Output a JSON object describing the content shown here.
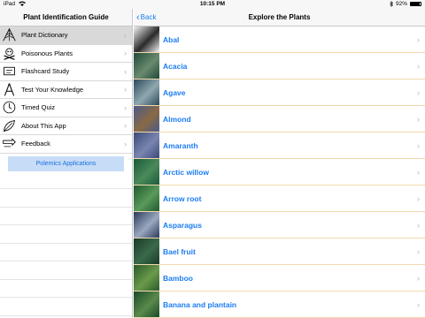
{
  "status_bar": {
    "device": "iPad",
    "wifi_icon": "wifi-icon",
    "time": "10:15 PM",
    "bluetooth_icon": "bluetooth-icon",
    "battery": "92%",
    "battery_level": 0.92
  },
  "master": {
    "title": "Plant Identification Guide",
    "items": [
      {
        "label": "Plant Dictionary",
        "icon": "plant-icon",
        "selected": true
      },
      {
        "label": "Poisonous Plants",
        "icon": "skull-crossbones-icon",
        "selected": false
      },
      {
        "label": "Flashcard Study",
        "icon": "flashcard-icon",
        "selected": false
      },
      {
        "label": "Test Your Knowledge",
        "icon": "compass-icon",
        "selected": false
      },
      {
        "label": "Timed Quiz",
        "icon": "clock-icon",
        "selected": false
      },
      {
        "label": "About This App",
        "icon": "leaf-icon",
        "selected": false
      },
      {
        "label": "Feedback",
        "icon": "feedback-icon",
        "selected": false
      }
    ],
    "polemics_label": "Polemics Applications"
  },
  "detail": {
    "back_label": "Back",
    "title": "Explore the Plants",
    "plants": [
      {
        "name": "Abal",
        "thumb_colors": [
          "#f4f4f4",
          "#2a2a2a"
        ]
      },
      {
        "name": "Acacia",
        "thumb_colors": [
          "#1f4a3a",
          "#6a8a6e"
        ]
      },
      {
        "name": "Agave",
        "thumb_colors": [
          "#2c4a5a",
          "#8fa8b0"
        ]
      },
      {
        "name": "Almond",
        "thumb_colors": [
          "#4a5a8a",
          "#8a6a44"
        ]
      },
      {
        "name": "Amaranth",
        "thumb_colors": [
          "#3a4a7a",
          "#7a86b0"
        ]
      },
      {
        "name": "Arctic willow",
        "thumb_colors": [
          "#1a5a3a",
          "#4a8a5a"
        ]
      },
      {
        "name": "Arrow root",
        "thumb_colors": [
          "#205a30",
          "#5a9a5a"
        ]
      },
      {
        "name": "Asparagus",
        "thumb_colors": [
          "#2a3a5a",
          "#9aa8c0"
        ]
      },
      {
        "name": "Bael fruit",
        "thumb_colors": [
          "#1a3a2a",
          "#3a6a4a"
        ]
      },
      {
        "name": "Bamboo",
        "thumb_colors": [
          "#2a5a2a",
          "#6a9a4a"
        ]
      },
      {
        "name": "Banana and plantain",
        "thumb_colors": [
          "#1a4a2a",
          "#5a8a4a"
        ]
      }
    ]
  }
}
